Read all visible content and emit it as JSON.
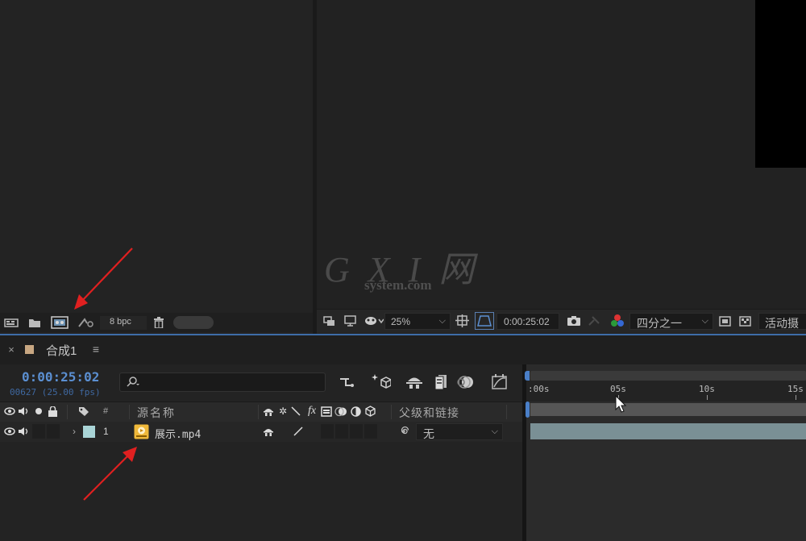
{
  "project_panel": {
    "bit_depth": "8 bpc"
  },
  "viewer_toolbar": {
    "zoom": "25%",
    "timecode": "0:00:25:02",
    "resolution": "四分之一",
    "camera": "活动摄"
  },
  "timeline": {
    "tab_label": "合成1",
    "current_time": "0:00:25:02",
    "frame_info": "00627 (25.00 fps)",
    "columns": {
      "hash": "#",
      "source_name": "源名称",
      "parent": "父级和链接"
    },
    "ruler_ticks": [
      ":00s",
      "05s",
      "10s",
      "15s"
    ],
    "layers": [
      {
        "number": "1",
        "name": "展示.mp4",
        "parent": "无",
        "label_color": "#a9d4d6"
      }
    ]
  },
  "watermark": {
    "title": "G X I 网",
    "subtitle": "system.com"
  },
  "colors": {
    "accent_blue": "#3e6da8",
    "timecode_blue": "#5b8fd1",
    "layer_bar": "#7a9095",
    "arrow_red": "#e02020"
  }
}
